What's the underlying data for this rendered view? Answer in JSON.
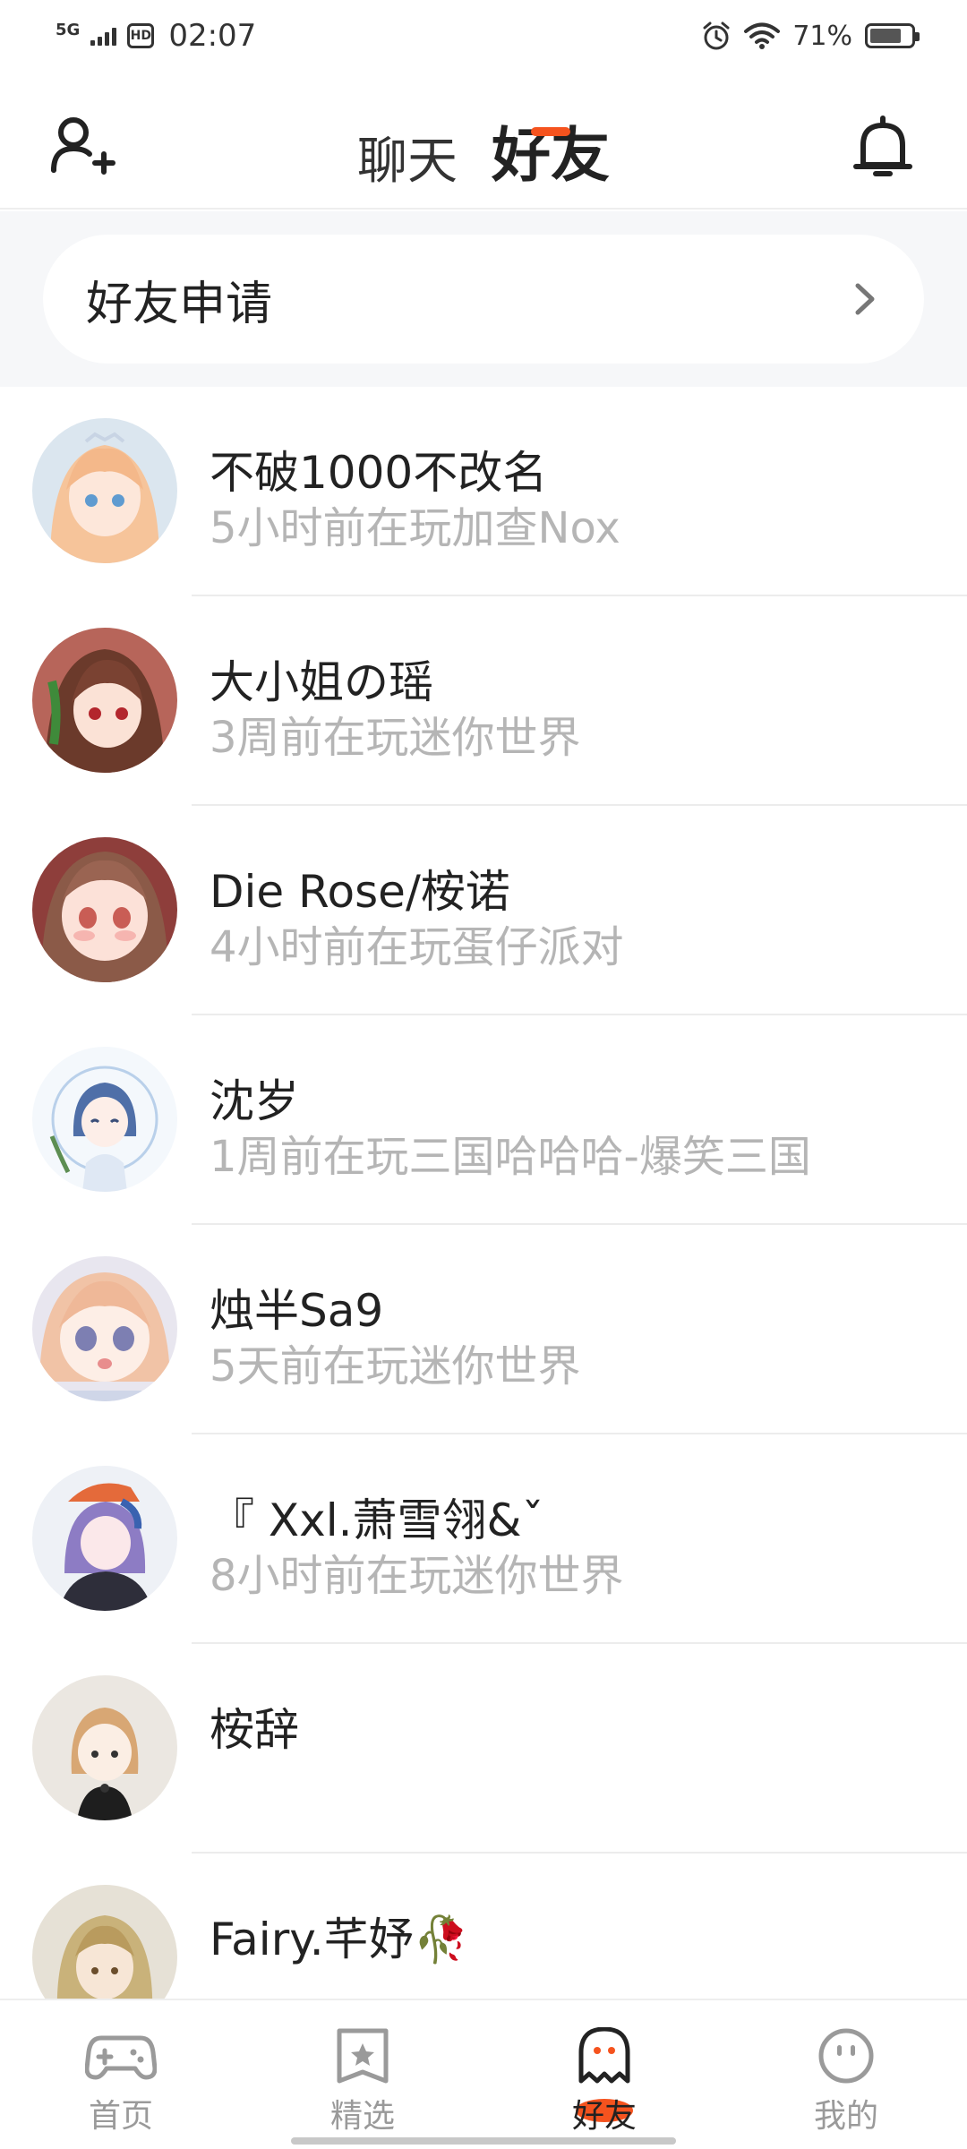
{
  "status_bar": {
    "network": "5G",
    "hd": "HD",
    "time": "02:07",
    "battery": "71%",
    "battery_level": 0.71
  },
  "header": {
    "tabs": [
      {
        "label": "聊天",
        "active": false
      },
      {
        "label": "好友",
        "active": true
      }
    ],
    "accent_color": "#f5531e"
  },
  "friend_request": {
    "label": "好友申请"
  },
  "friends": [
    {
      "name": "不破1000不改名",
      "activity": "5小时前在玩加查Nox",
      "avatar_theme": "#f3d3c0"
    },
    {
      "name": "大小姐の瑶",
      "activity": "3周前在玩迷你世界",
      "avatar_theme": "#8a4f3e"
    },
    {
      "name": "Die  Rose/桉诺",
      "activity": "4小时前在玩蛋仔派对",
      "avatar_theme": "#b06a60"
    },
    {
      "name": "沈岁",
      "activity": "1周前在玩三国哈哈哈-爆笑三国",
      "avatar_theme": "#a9c3e6"
    },
    {
      "name": "烛半Sa9",
      "activity": "5天前在玩迷你世界",
      "avatar_theme": "#d8cfe6"
    },
    {
      "name": "『  Xxl.萧雪翎&ˇ",
      "activity": "8小时前在玩迷你世界",
      "avatar_theme": "#7a6fa8"
    },
    {
      "name": "桉辞",
      "activity": "",
      "avatar_theme": "#e9e3dc"
    },
    {
      "name": "Fairy.芊妤🥀",
      "activity": "",
      "avatar_theme": "#d9c79a"
    }
  ],
  "bottom_nav": [
    {
      "label": "首页",
      "icon": "gamepad-icon",
      "active": false
    },
    {
      "label": "精选",
      "icon": "star-bookmark-icon",
      "active": false
    },
    {
      "label": "好友",
      "icon": "ghost-icon",
      "active": true
    },
    {
      "label": "我的",
      "icon": "smiley-icon",
      "active": false
    }
  ]
}
